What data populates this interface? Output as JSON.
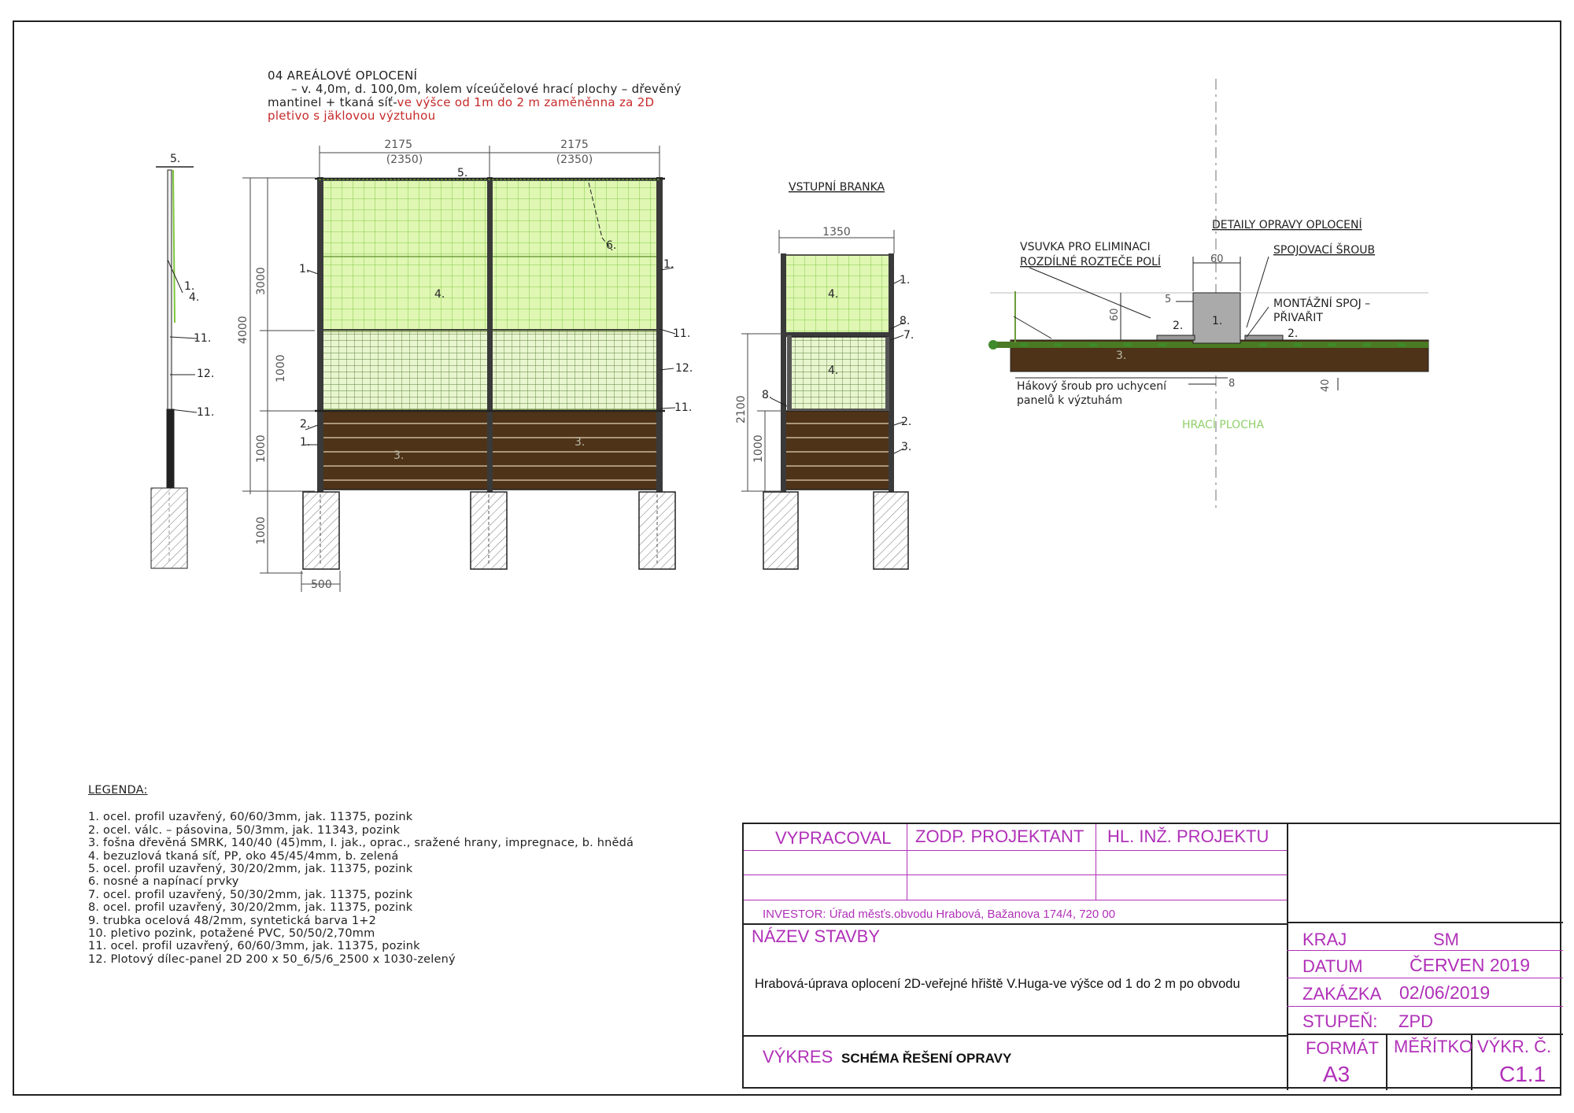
{
  "description": {
    "line1": "04 AREÁLOVÉ OPLOCENÍ",
    "line2": "– v. 4,0m, d. 100,0m, kolem víceúčelové hrací plochy – dřevěný",
    "line3_black": "mantinel + tkaná síť-",
    "line3_red": "ve výšce od 1m do 2 m zaměněnna za 2D",
    "line4_red": "pletivo s jäklovou výztuhou"
  },
  "main_fence": {
    "dim_top_left": "2175",
    "dim_top_left_sub": "(2350)",
    "dim_top_right": "2175",
    "dim_top_right_sub": "(2350)",
    "dim_3000": "3000",
    "dim_4000": "4000",
    "dim_1000_a": "1000",
    "dim_1000_b": "1000",
    "dim_1000_c": "1000",
    "dim_500": "500",
    "labels": {
      "top": "5.",
      "net": "4.",
      "tension": "6.",
      "post_left": "1.",
      "post_right": "1.",
      "rail": "11.",
      "panel": "12.",
      "rail2": "11.",
      "strip_left": "2.",
      "post_left2": "1.",
      "boards_left": "3.",
      "boards_right": "3."
    }
  },
  "side_view": {
    "labels": {
      "top": "5.",
      "post": "1.",
      "net": "4.",
      "rail": "11.",
      "panel": "12.",
      "rail2": "11."
    }
  },
  "gate": {
    "title": "VSTUPNÍ BRANKA",
    "dim_width": "1350",
    "dim_2100": "2100",
    "dim_1000": "1000",
    "labels": {
      "post": "1.",
      "net_top": "4.",
      "frame8": "8.",
      "frame7": "7.",
      "net_gate": "4.",
      "frame8_left": "8.",
      "strip": "2.",
      "boards": "3."
    }
  },
  "detail": {
    "title": "DETAILY OPRAVY OPLOCENÍ",
    "vsuvka_1": "VSUVKA PRO ELIMINACI",
    "vsuvka_2": "ROZDÍLNÉ ROZTEČE POLÍ",
    "screw": "SPOJOVACÍ ŠROUB",
    "mont_1": "MONTÁŽNÍ SPOJ –",
    "mont_2": "PŘIVAŘIT",
    "hook_1": "Hákový šroub pro uchycení",
    "hook_2": "panelů k výztuhám",
    "area": "HRACÍ PLOCHA",
    "dim_60_top": "60",
    "dim_60_side": "60",
    "dim_5": "5",
    "dim_8": "8",
    "dim_40": "40",
    "l1": "1.",
    "l2a": "2.",
    "l2b": "2.",
    "l3": "3."
  },
  "legend": {
    "title": "LEGENDA:",
    "items": [
      "1. ocel. profil uzavřený, 60/60/3mm, jak. 11375, pozink",
      "2. ocel. válc. – pásovina, 50/3mm, jak. 11343, pozink",
      "3. fošna dřevěná SMRK, 140/40 (45)mm, I. jak., oprac., sražené hrany, impregnace, b. hnědá",
      "4. bezuzlová tkaná síť, PP, oko 45/45/4mm, b. zelená",
      "5. ocel. profil uzavřený, 30/20/2mm, jak. 11375, pozink",
      "6. nosné a napínací prvky",
      "7. ocel. profil uzavřený, 50/30/2mm, jak. 11375, pozink",
      "8. ocel. profil uzavřený, 30/20/2mm, jak. 11375, pozink",
      "9. trubka ocelová 48/2mm, syntetická barva 1+2",
      "10. pletivo pozink, potažené PVC, 50/50/2,70mm",
      "11. ocel. profil uzavřený, 60/60/3mm, jak. 11375, pozink",
      "12. Plotový dílec-panel 2D 200 x 50_6/5/6_2500 x 1030-zelený"
    ]
  },
  "title_block": {
    "vypracoval": "VYPRACOVAL",
    "zodp": "ZODP. PROJEKTANT",
    "hl_inz": "HL. INŽ. PROJEKTU",
    "investor": "INVESTOR: Úřad měsťs.obvodu Hrabová, Bažanova 174/4, 720 00",
    "nazev_label": "NÁZEV STAVBY",
    "nazev_value": "Hrabová-úprava oplocení 2D-veřejné hřiště V.Huga-ve výšce od 1 do 2 m po obvodu",
    "kraj_label": "KRAJ",
    "kraj_value": "SM",
    "datum_label": "DATUM",
    "datum_value": "ČERVEN 2019",
    "zakazka_label": "ZAKÁZKA",
    "zakazka_value": "02/06/2019",
    "stupen_label": "STUPEŇ:",
    "stupen_value": "ZPD",
    "vykres_label": "VÝKRES",
    "vykres_value": "SCHÉMA ŘEŠENÍ OPRAVY",
    "format_label": "FORMÁT",
    "format_value": "A3",
    "meritko_label": "MĚŘÍTKO",
    "vykr_c_label": "VÝKR. Č.",
    "vykr_c_value": "C1.1"
  },
  "colors": {
    "mesh": "#dff7b3",
    "mesh_grid": "#7ec63a",
    "wood": "#4e3318",
    "ink": "#222222",
    "magenta": "#b030b8",
    "red_note": "#c62a2a"
  }
}
